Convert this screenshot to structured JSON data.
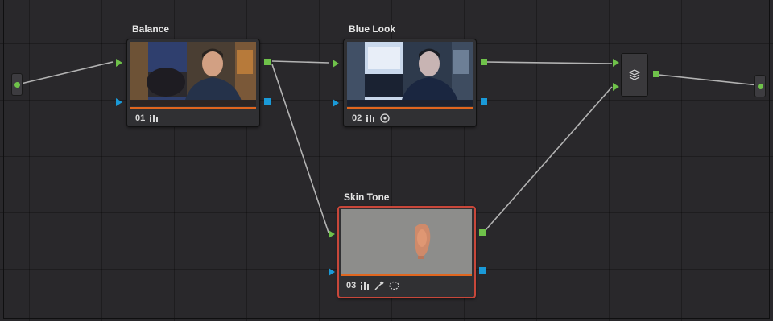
{
  "nodes": [
    {
      "id": "01",
      "label": "Balance",
      "tools": [
        "curves-icon"
      ]
    },
    {
      "id": "02",
      "label": "Blue Look",
      "tools": [
        "curves-icon",
        "circle-window-icon"
      ]
    },
    {
      "id": "03",
      "label": "Skin Tone",
      "tools": [
        "curves-icon",
        "qualifier-icon",
        "tracker-icon"
      ]
    }
  ],
  "mixer": {
    "icon": "layer-mixer-icon"
  },
  "colors": {
    "rgb_link": "#6fc24a",
    "alpha_link": "#1a9ad8",
    "selected_border": "#c8473a",
    "node_bar": "#e0661f",
    "canvas_bg": "#29282b"
  }
}
